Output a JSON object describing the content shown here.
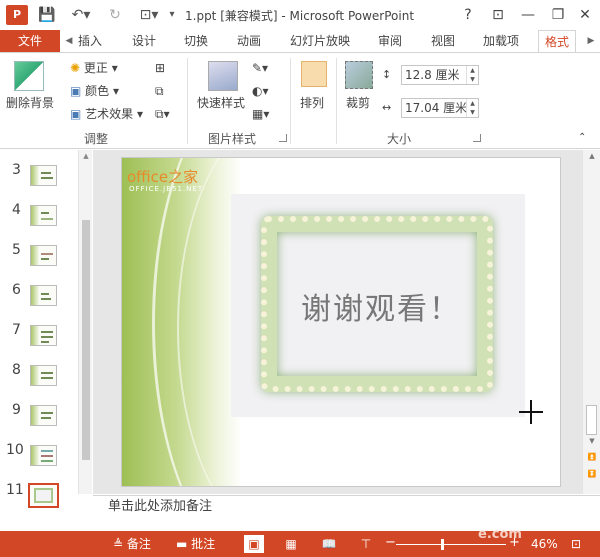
{
  "title_bar": {
    "app_icon_text": "P",
    "title": "1.ppt [兼容模式] - Microsoft PowerPoint",
    "help": "?",
    "minimize": "—",
    "restore": "❐",
    "close": "✕"
  },
  "tabs": [
    {
      "label": "文件"
    },
    {
      "label": "插入"
    },
    {
      "label": "设计"
    },
    {
      "label": "切换"
    },
    {
      "label": "动画"
    },
    {
      "label": "幻灯片放映"
    },
    {
      "label": "审阅"
    },
    {
      "label": "视图"
    },
    {
      "label": "加载项"
    },
    {
      "label": "格式"
    }
  ],
  "ribbon": {
    "remove_bg": "删除背景",
    "corrections": "更正",
    "color": "颜色",
    "artistic_effects": "艺术效果",
    "adjust_group": "调整",
    "quick_styles": "快速样式",
    "picture_styles_group": "图片样式",
    "arrange": "排列",
    "crop": "裁剪",
    "height_value": "12.8 厘米",
    "width_value": "17.04 厘米",
    "size_group": "大小"
  },
  "thumbnails": [
    {
      "num": "3"
    },
    {
      "num": "4"
    },
    {
      "num": "5"
    },
    {
      "num": "6"
    },
    {
      "num": "7"
    },
    {
      "num": "8"
    },
    {
      "num": "9"
    },
    {
      "num": "10"
    },
    {
      "num": "11"
    }
  ],
  "slide": {
    "logo": "office之家",
    "logo_sub": "OFFICE.JB51.NET",
    "text": "谢谢观看！"
  },
  "notes_placeholder": "单击此处添加备注",
  "status": {
    "notes": "备注",
    "comments": "批注",
    "zoom_out": "−",
    "zoom_in": "+",
    "zoom": "46%",
    "watermark": "e.com"
  }
}
